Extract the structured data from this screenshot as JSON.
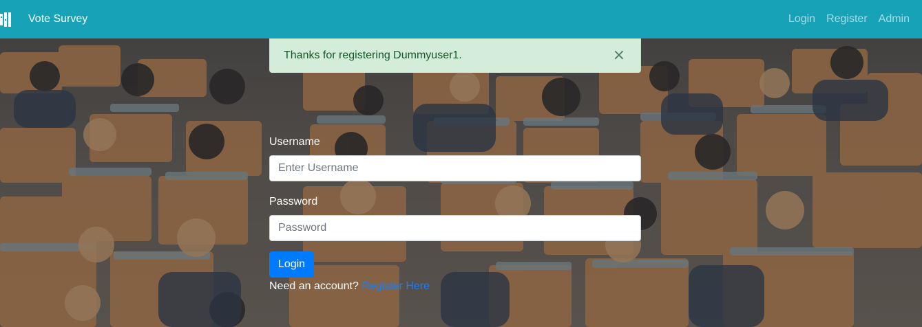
{
  "navbar": {
    "brand": "Vote Survey",
    "brand_icon": "columns-icon",
    "links": [
      "Login",
      "Register",
      "Admin"
    ]
  },
  "alert": {
    "message": "Thanks for registering Dummyuser1.",
    "close": "×",
    "type": "success"
  },
  "form": {
    "username_label": "Username",
    "username_placeholder": "Enter Username",
    "password_label": "Password",
    "password_placeholder": "Password",
    "login_button": "Login",
    "account_prompt": "Need an account?",
    "register_link": "Register Here"
  },
  "colors": {
    "navbar": "#17a2b8",
    "alert_bg": "#d4edda",
    "alert_text": "#155724",
    "primary": "#007bff"
  }
}
